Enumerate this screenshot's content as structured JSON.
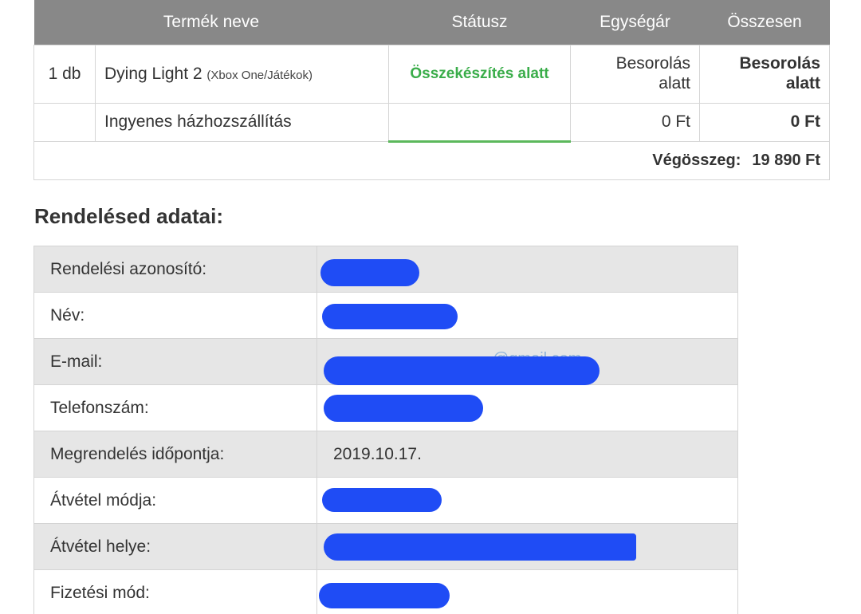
{
  "order_table": {
    "headers": {
      "product_name": "Termék neve",
      "status": "Státusz",
      "unit_price": "Egységár",
      "total": "Összesen"
    },
    "product_row": {
      "quantity": "1 db",
      "name": "Dying Light 2",
      "platform": "(Xbox One/Játékok)",
      "status": "Összekészítés alatt",
      "unit_price_line1": "Besorolás",
      "unit_price_line2": "alatt",
      "total_line1": "Besorolás",
      "total_line2": "alatt"
    },
    "shipping_row": {
      "name": "Ingyenes házhozszállítás",
      "unit_price": "0 Ft",
      "total": "0 Ft"
    },
    "summary": {
      "label": "Végösszeg:",
      "value": "19 890 Ft"
    }
  },
  "details": {
    "title": "Rendelésed adatai:",
    "rows": [
      {
        "label": "Rendelési azonosító:",
        "value": ""
      },
      {
        "label": "Név:",
        "value": ""
      },
      {
        "label": "E-mail:",
        "value": "@gmail.com"
      },
      {
        "label": "Telefonszám:",
        "value": ""
      },
      {
        "label": "Megrendelés időpontja:",
        "value": "2019.10.17."
      },
      {
        "label": "Átvétel módja:",
        "value": ""
      },
      {
        "label": "Átvétel helye:",
        "value": ""
      },
      {
        "label": "Fizetési mód:",
        "value": ""
      }
    ]
  },
  "colors": {
    "header_bg": "#888888",
    "status_green": "#3aad4a",
    "progress_green": "#5cb85c",
    "redaction_blue": "#1f4cf5",
    "row_stripe": "#e6e6e6"
  }
}
